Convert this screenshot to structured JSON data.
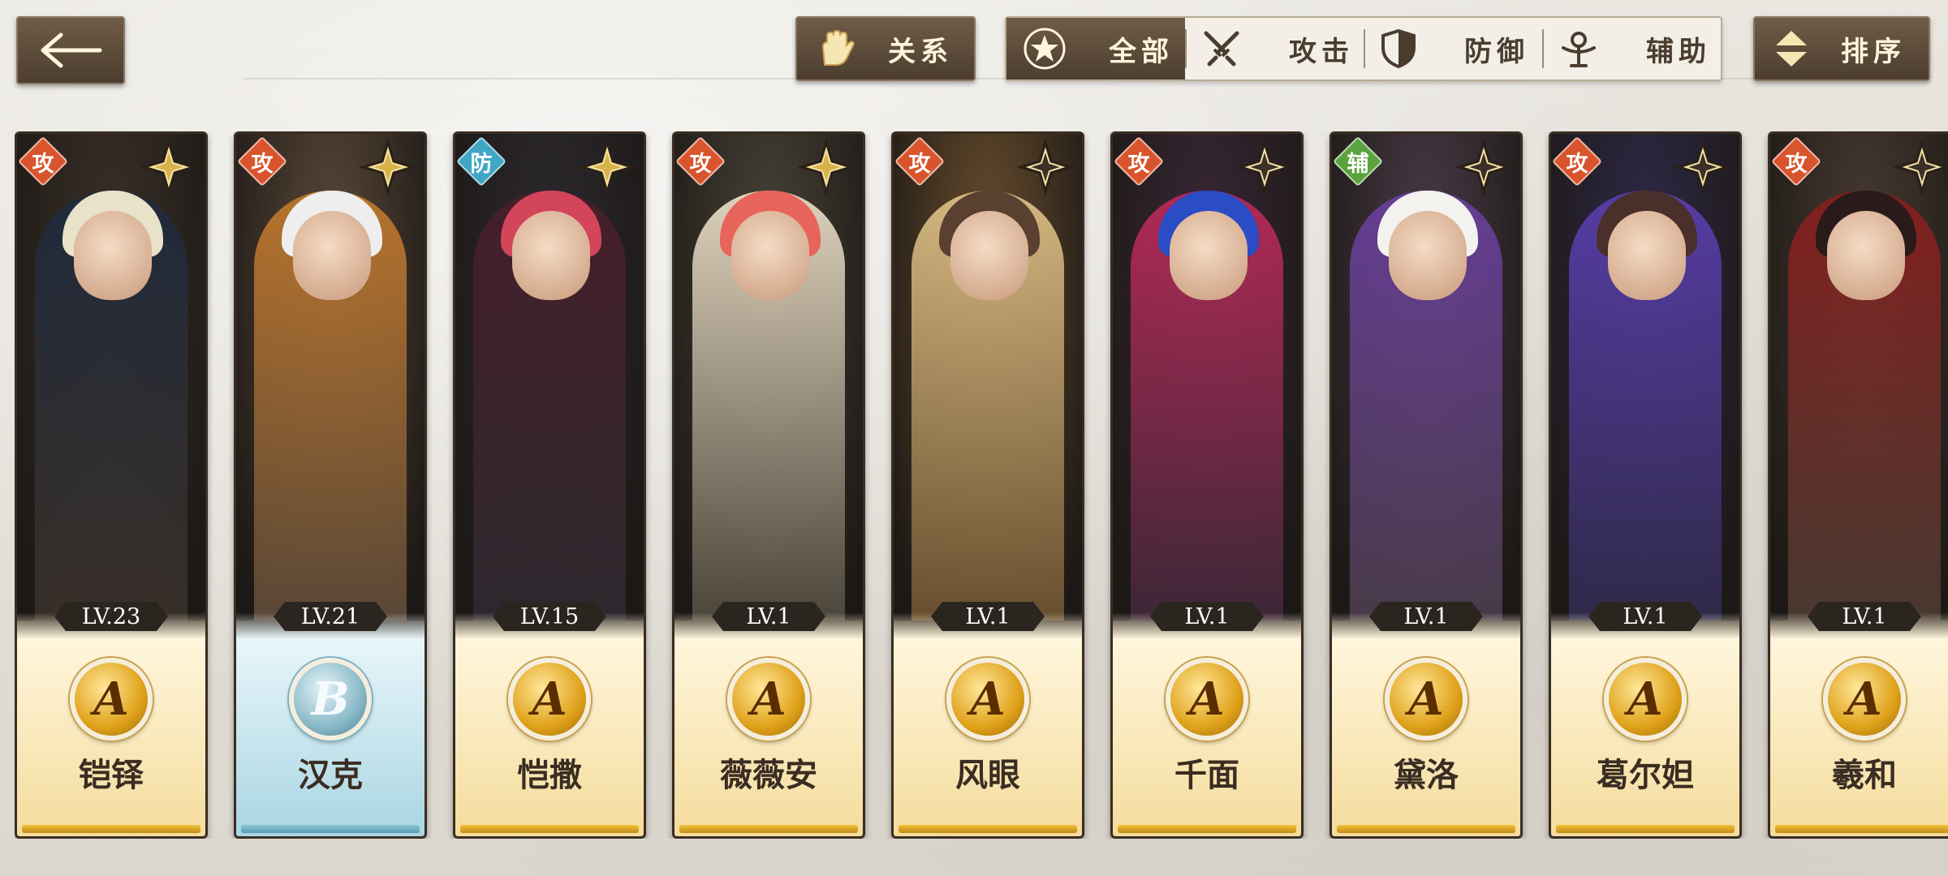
{
  "header": {
    "back_icon": "arrow-left-icon",
    "relation": {
      "label": "关系",
      "icon": "glove-icon"
    },
    "sort": {
      "label": "排序",
      "icon": "sort-updown-icon"
    },
    "filters": [
      {
        "label": "全部",
        "icon": "star-circle-icon",
        "active": true
      },
      {
        "label": "攻击",
        "icon": "crossed-swords-icon",
        "active": false
      },
      {
        "label": "防御",
        "icon": "shield-icon",
        "active": false
      },
      {
        "label": "辅助",
        "icon": "support-figure-icon",
        "active": false
      }
    ]
  },
  "roles": {
    "attack": "攻",
    "defense": "防",
    "support": "辅"
  },
  "colors": {
    "attack_badge": "#d8542c",
    "defense_badge": "#3fa6c4",
    "support_badge": "#5aa33e",
    "grade_a": "#e0a21a",
    "grade_b": "#89b9c8"
  },
  "characters": [
    {
      "name": "铠铎",
      "level": "LV.23",
      "grade": "A",
      "role": "攻",
      "star_filled": true
    },
    {
      "name": "汉克",
      "level": "LV.21",
      "grade": "B",
      "role": "攻",
      "star_filled": true
    },
    {
      "name": "恺撒",
      "level": "LV.15",
      "grade": "A",
      "role": "防",
      "star_filled": true
    },
    {
      "name": "薇薇安",
      "level": "LV.1",
      "grade": "A",
      "role": "攻",
      "star_filled": true
    },
    {
      "name": "风眼",
      "level": "LV.1",
      "grade": "A",
      "role": "攻",
      "star_filled": false
    },
    {
      "name": "千面",
      "level": "LV.1",
      "grade": "A",
      "role": "攻",
      "star_filled": false
    },
    {
      "name": "黛洛",
      "level": "LV.1",
      "grade": "A",
      "role": "辅",
      "star_filled": false
    },
    {
      "name": "葛尔妲",
      "level": "LV.1",
      "grade": "A",
      "role": "攻",
      "star_filled": false
    },
    {
      "name": "羲和",
      "level": "LV.1",
      "grade": "A",
      "role": "攻",
      "star_filled": false
    }
  ]
}
